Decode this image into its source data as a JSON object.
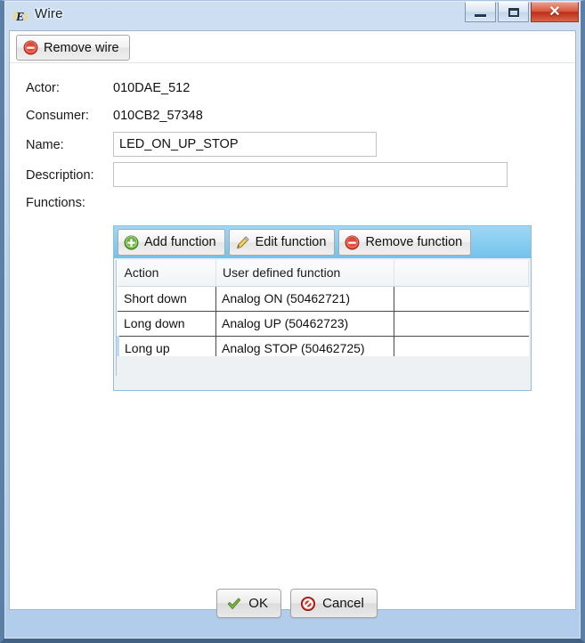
{
  "window": {
    "title": "Wire",
    "app_icon": "app-e-icon",
    "controls": {
      "minimize": "minimize-icon",
      "maximize": "maximize-icon",
      "close": "close-icon",
      "close_glyph": "✕"
    }
  },
  "toolbar": {
    "remove_wire_label": "Remove wire",
    "remove_wire_icon": "remove-circle-icon"
  },
  "form": {
    "actor_label": "Actor:",
    "actor_value": "010DAE_512",
    "consumer_label": "Consumer:",
    "consumer_value": "010CB2_57348",
    "name_label": "Name:",
    "name_value": "LED_ON_UP_STOP",
    "name_placeholder": "",
    "description_label": "Description:",
    "description_value": "",
    "description_placeholder": "",
    "functions_label": "Functions:"
  },
  "functions_panel": {
    "buttons": [
      {
        "label": "Add function",
        "icon": "add-circle-icon"
      },
      {
        "label": "Edit function",
        "icon": "pencil-icon"
      },
      {
        "label": "Remove function",
        "icon": "remove-circle-icon"
      }
    ],
    "grid": {
      "columns": [
        "Action",
        "User defined function",
        ""
      ],
      "rows": [
        {
          "action": "Short down",
          "function": "Analog ON (50462721)",
          "extra": "",
          "selected": false
        },
        {
          "action": "Long down",
          "function": "Analog UP (50462723)",
          "extra": "",
          "selected": false
        },
        {
          "action": "Long up",
          "function": "Analog STOP (50462725)",
          "extra": "",
          "selected": true
        }
      ]
    }
  },
  "footer": {
    "ok_label": "OK",
    "ok_icon": "check-icon",
    "cancel_label": "Cancel",
    "cancel_icon": "cancel-icon"
  },
  "colors": {
    "titlebar": "#b9d1ee",
    "toolbar_accent": "#72c2ec",
    "remove_red": "#e04a3a",
    "add_green": "#6cb33f",
    "pencil_yellow": "#e8b83a",
    "ok_green": "#7cba3d",
    "cancel_red": "#d8342a",
    "selection_blue": "#b9dcf0"
  }
}
